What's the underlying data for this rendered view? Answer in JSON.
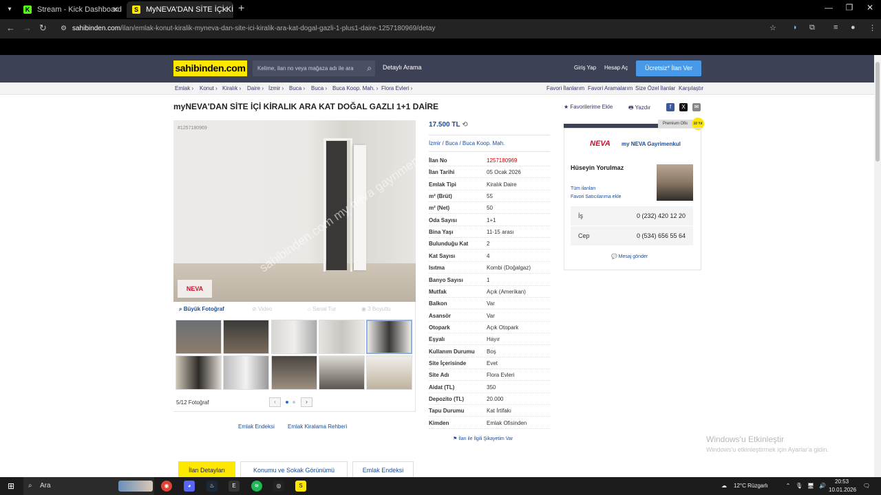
{
  "browser": {
    "tabs": [
      {
        "title": "Stream - Kick Dashboard",
        "favicon": "K"
      },
      {
        "title": "MyNEVA'DAN SİTE İÇİ KİRALIK",
        "favicon": "S"
      }
    ],
    "url_host": "sahibinden.com",
    "url_path": "/ilan/emlak-konut-kiralik-myneva-dan-site-ici-kiralik-ara-kat-dogal-gazli-1-plus1-daire-1257180969/detay"
  },
  "header": {
    "logo": "sahibinden.com",
    "search_placeholder": "Kelime, ilan no veya mağaza adı ile ara",
    "detailed_search": "Detaylı Arama",
    "login": "Giriş Yap",
    "register": "Hesap Aç",
    "post_ad": "Ücretsiz* İlan Ver"
  },
  "breadcrumbs": [
    "Emlak ›",
    "Konut ›",
    "Kiralık ›",
    "Daire ›",
    "İzmir ›",
    "Buca ›",
    "Buca ›",
    "Buca Koop. Mah. ›",
    "Flora Evleri ›"
  ],
  "top_links": [
    "Favori İlanlarım",
    "Favori Aramalarım",
    "Size Özel İlanlar",
    "Karşılaştır"
  ],
  "listing": {
    "title": "myNEVA'DAN SİTE İÇİ KİRALIK ARA KAT DOĞAL GAZLI 1+1 DAİRE",
    "add_favorite": "Favorilerime Ekle",
    "print": "Yazdır",
    "photo_id": "#1257180969",
    "watermark": "sahibinden.com my neva gayrimenkul",
    "photo_logo": "NEVA",
    "tools": [
      "Büyük Fotoğraf",
      "Video",
      "Sanal Tur",
      "3 Boyutlu"
    ],
    "photo_counter": "5/12 Fotoğraf",
    "bottom_links": [
      "Emlak Endeksi",
      "Emlak Kiralama Rehberi"
    ],
    "price": "17.500 TL",
    "location": "İzmir  /  Buca  /  Buca Koop. Mah.",
    "details": [
      {
        "k": "İlan No",
        "v": "1257180969"
      },
      {
        "k": "İlan Tarihi",
        "v": "05 Ocak 2026"
      },
      {
        "k": "Emlak Tipi",
        "v": "Kiralık Daire"
      },
      {
        "k": "m² (Brüt)",
        "v": "55"
      },
      {
        "k": "m² (Net)",
        "v": "50"
      },
      {
        "k": "Oda Sayısı",
        "v": "1+1"
      },
      {
        "k": "Bina Yaşı",
        "v": "11-15 arası"
      },
      {
        "k": "Bulunduğu Kat",
        "v": "2"
      },
      {
        "k": "Kat Sayısı",
        "v": "4"
      },
      {
        "k": "Isıtma",
        "v": "Kombi (Doğalgaz)"
      },
      {
        "k": "Banyo Sayısı",
        "v": "1"
      },
      {
        "k": "Mutfak",
        "v": "Açık (Amerikan)"
      },
      {
        "k": "Balkon",
        "v": "Var"
      },
      {
        "k": "Asansör",
        "v": "Var"
      },
      {
        "k": "Otopark",
        "v": "Açık Otopark"
      },
      {
        "k": "Eşyalı",
        "v": "Hayır"
      },
      {
        "k": "Kullanım Durumu",
        "v": "Boş"
      },
      {
        "k": "Site İçerisinde",
        "v": "Evet"
      },
      {
        "k": "Site Adı",
        "v": "Flora Evleri"
      },
      {
        "k": "Aidat (TL)",
        "v": "350"
      },
      {
        "k": "Depozito (TL)",
        "v": "20.000"
      },
      {
        "k": "Tapu Durumu",
        "v": "Kat İrtifakı"
      },
      {
        "k": "Kimden",
        "v": "Emlak Ofisinden"
      }
    ],
    "complaint": "İlan ile İlgili Şikayetim Var"
  },
  "seller": {
    "premium": "Premium Ofis",
    "badge": "10 Yıl",
    "logo": "NEVA",
    "store": "my NEVA Gayrimenkul",
    "person": "Hüseyin Yorulmaz",
    "all_ads": "Tüm ilanları",
    "fav_seller": "Favori Satıcılarıma ekle",
    "phones": [
      {
        "k": "İş",
        "v": "0 (232) 420 12 20"
      },
      {
        "k": "Cep",
        "v": "0 (534) 656 55 64"
      }
    ],
    "message": "Mesaj gönder"
  },
  "bottom_tabs": [
    "İlan Detayları",
    "Konumu ve Sokak Görünümü",
    "Emlak Endeksi"
  ],
  "windows_activation": {
    "title": "Windows'u Etkinleştir",
    "subtitle": "Windows'u etkinleştirmek için Ayarlar'a gidin."
  },
  "taskbar": {
    "search": "Ara",
    "weather": "12°C  Rüzgarlı",
    "time": "20:53",
    "date": "10.01.2026"
  },
  "colors": {
    "brand_yellow": "#ffe800",
    "header_bg": "#3c4156",
    "link": "#1a4c9c",
    "post_ad": "#489ae9"
  }
}
